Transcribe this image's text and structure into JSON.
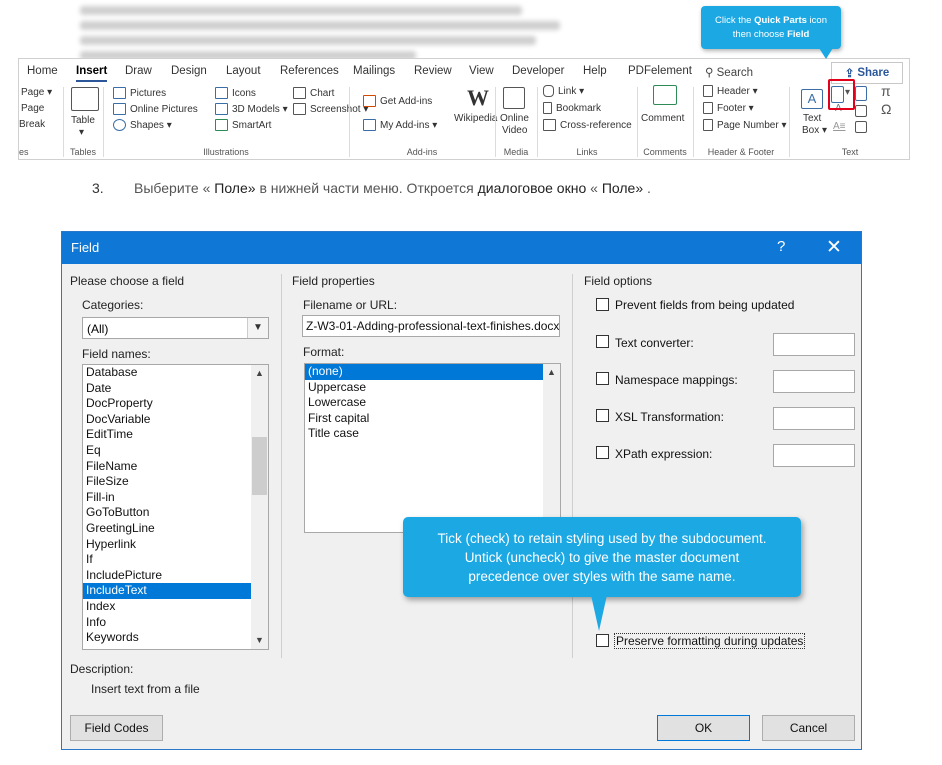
{
  "ribbon": {
    "tabs": [
      "Home",
      "Insert",
      "Draw",
      "Design",
      "Layout",
      "References",
      "Mailings",
      "Review",
      "View",
      "Developer",
      "Help",
      "PDFelement"
    ],
    "active_tab": "Insert",
    "search": "Search",
    "share": "Share",
    "pages_group": {
      "items": [
        "Page ▾",
        "Page",
        "Break"
      ],
      "label": "es"
    },
    "tables_group": {
      "button": "Table",
      "label": "Tables"
    },
    "illustrations_group": {
      "col1": [
        "Pictures",
        "Online Pictures",
        "Shapes ▾"
      ],
      "col2": [
        "Icons",
        "3D Models ▾",
        "SmartArt"
      ],
      "col3": [
        "Chart",
        "Screenshot ▾"
      ],
      "label": "Illustrations"
    },
    "addins_group": {
      "get": "Get Add-ins",
      "my": "My Add-ins ▾",
      "wikipedia": "Wikipedia",
      "label": "Add-ins"
    },
    "media_group": {
      "online": "Online",
      "video": "Video",
      "label": "Media"
    },
    "links_group": {
      "items": [
        "Link ▾",
        "Bookmark",
        "Cross-reference"
      ],
      "label": "Links"
    },
    "comments_group": {
      "button": "Comment",
      "label": "Comments"
    },
    "header_footer_group": {
      "items": [
        "Header ▾",
        "Footer ▾",
        "Page Number ▾"
      ],
      "label": "Header & Footer"
    },
    "text_group": {
      "text": "Text",
      "box": "Box ▾",
      "label": "Text"
    },
    "callout": {
      "line1_pre": "Click the ",
      "line1_bold": "Quick Parts",
      "line1_post": " icon",
      "line2_pre": "then choose ",
      "line2_bold": "Field"
    }
  },
  "instruction": {
    "number": "3.",
    "t1": "Выберите « ",
    "b1": "Поле»",
    "t2": " в нижней части меню. Откроется ",
    "b2": "диалоговое окно",
    "t3": " « ",
    "b3": "Поле»",
    "t4": " ."
  },
  "dialog": {
    "title": "Field",
    "help": "?",
    "close": "✕",
    "left_section": "Please choose a field",
    "categories_label": "Categories:",
    "categories_value": "(All)",
    "field_names_label": "Field names:",
    "field_names": [
      "Database",
      "Date",
      "DocProperty",
      "DocVariable",
      "EditTime",
      "Eq",
      "FileName",
      "FileSize",
      "Fill-in",
      "GoToButton",
      "GreetingLine",
      "Hyperlink",
      "If",
      "IncludePicture",
      "IncludeText",
      "Index",
      "Info",
      "Keywords"
    ],
    "field_names_selected": "IncludeText",
    "description_label": "Description:",
    "description_text": "Insert text from a file",
    "properties_section": "Field properties",
    "filename_label": "Filename or URL:",
    "filename_value": "Z-W3-01-Adding-professional-text-finishes.docx",
    "format_label": "Format:",
    "formats": [
      "(none)",
      "Uppercase",
      "Lowercase",
      "First capital",
      "Title case"
    ],
    "format_selected": "(none)",
    "options_section": "Field options",
    "options": {
      "prevent": "Prevent fields from being updated",
      "text_converter": "Text converter:",
      "namespace": "Namespace mappings:",
      "xsl": "XSL Transformation:",
      "xpath": "XPath expression:",
      "preserve": "Preserve formatting during updates"
    },
    "field_codes_button": "Field Codes",
    "ok_button": "OK",
    "cancel_button": "Cancel",
    "callout": {
      "line1": "Tick (check) to retain styling used by the subdocument.",
      "line2": "Untick (uncheck) to give the master document",
      "line3": "precedence over styles with the same name."
    }
  }
}
